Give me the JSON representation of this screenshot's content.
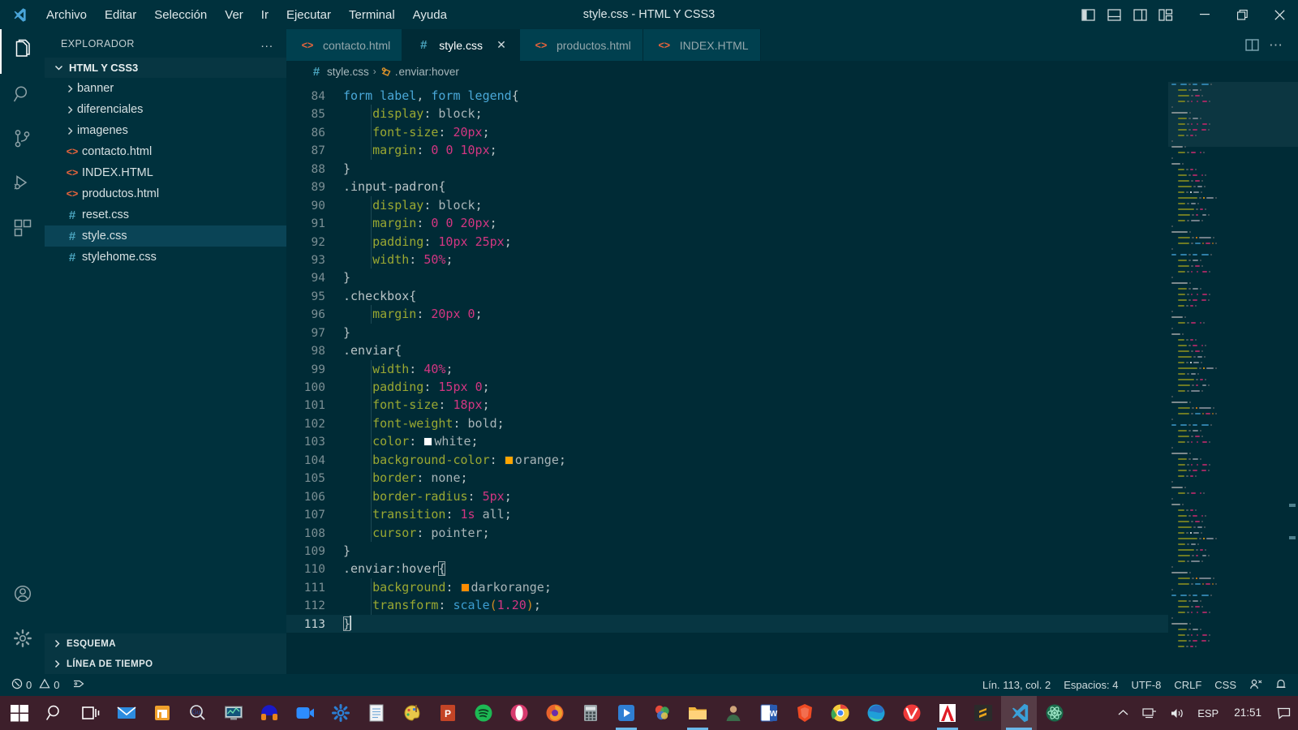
{
  "titlebar": {
    "window_title": "style.css - HTML Y CSS3",
    "menus": [
      "Archivo",
      "Editar",
      "Selección",
      "Ver",
      "Ir",
      "Ejecutar",
      "Terminal",
      "Ayuda"
    ],
    "layout_buttons": [
      "toggle-primary-sidebar",
      "toggle-panel",
      "toggle-secondary-sidebar",
      "customize-layout"
    ],
    "window_controls": [
      "minimize",
      "restore",
      "close"
    ]
  },
  "activitybar": {
    "items": [
      {
        "name": "explorer",
        "icon": "files-icon",
        "active": true
      },
      {
        "name": "search",
        "icon": "search-icon",
        "active": false
      },
      {
        "name": "source-control",
        "icon": "source-control-icon",
        "active": false
      },
      {
        "name": "run-debug",
        "icon": "run-debug-icon",
        "active": false
      },
      {
        "name": "extensions",
        "icon": "extensions-icon",
        "active": false
      }
    ],
    "bottom": [
      {
        "name": "accounts",
        "icon": "account-icon"
      },
      {
        "name": "manage",
        "icon": "gear-icon"
      }
    ]
  },
  "sidebar": {
    "title": "EXPLORADOR",
    "more_actions": "...",
    "root_folder": "HTML Y CSS3",
    "items": [
      {
        "label": "banner",
        "type": "folder",
        "icon": "chevron-right-icon",
        "selected": false
      },
      {
        "label": "diferenciales",
        "type": "folder",
        "icon": "chevron-right-icon",
        "selected": false
      },
      {
        "label": "imagenes",
        "type": "folder",
        "icon": "chevron-right-icon",
        "selected": false
      },
      {
        "label": "contacto.html",
        "type": "html",
        "icon": "html-file-icon",
        "selected": false
      },
      {
        "label": "INDEX.HTML",
        "type": "html",
        "icon": "html-file-icon",
        "selected": false
      },
      {
        "label": "productos.html",
        "type": "html",
        "icon": "html-file-icon",
        "selected": false
      },
      {
        "label": "reset.css",
        "type": "css",
        "icon": "css-file-icon",
        "selected": false
      },
      {
        "label": "style.css",
        "type": "css",
        "icon": "css-file-icon",
        "selected": true
      },
      {
        "label": "stylehome.css",
        "type": "css",
        "icon": "css-file-icon",
        "selected": false
      }
    ],
    "panels": [
      "ESQUEMA",
      "LÍNEA DE TIEMPO"
    ]
  },
  "tabs": [
    {
      "label": "contacto.html",
      "type": "html",
      "active": false,
      "closable": false
    },
    {
      "label": "style.css",
      "type": "css",
      "active": true,
      "closable": true,
      "close_label": "✕"
    },
    {
      "label": "productos.html",
      "type": "html",
      "active": false,
      "closable": false
    },
    {
      "label": "INDEX.HTML",
      "type": "html",
      "active": false,
      "closable": false
    }
  ],
  "editor_actions": [
    {
      "name": "split-editor",
      "icon": "split-editor-icon"
    },
    {
      "name": "more-actions",
      "icon": "ellipsis-icon",
      "label": "⋯"
    }
  ],
  "breadcrumb": {
    "file": "style.css",
    "separator": "›",
    "symbol": "enviar:hover",
    "symbol_prefix": ".",
    "symbol_icon": "css-rule-icon"
  },
  "statusbar": {
    "errors": "0",
    "warnings": "0",
    "ports_icon": "remote-ports-icon",
    "cursor_position": "Lín. 113, col. 2",
    "indentation": "Espacios: 4",
    "encoding": "UTF-8",
    "eol": "CRLF",
    "language": "CSS",
    "feedback_icon": "feedback-icon",
    "bell_icon": "bell-icon"
  },
  "taskbar": {
    "tray_language": "ESP",
    "tray_time": "21:51",
    "tray_icons": [
      "show-hidden-icon",
      "network-icon",
      "volume-icon"
    ],
    "action_center_icon": "action-center-icon",
    "items": [
      {
        "name": "start-button",
        "icon": "windows-start-icon"
      },
      {
        "name": "search-taskbar",
        "icon": "search-icon"
      },
      {
        "name": "task-view",
        "icon": "task-view-icon"
      },
      {
        "name": "mail-app",
        "icon": "mail-icon"
      },
      {
        "name": "store-app",
        "icon": "store-icon"
      },
      {
        "name": "guitar-app",
        "icon": "gu-icon"
      },
      {
        "name": "monitor-app",
        "icon": "monitor-chart-icon"
      },
      {
        "name": "headphones-app",
        "icon": "headphones-icon"
      },
      {
        "name": "zoom-app",
        "icon": "zoom-camera-icon"
      },
      {
        "name": "settings-app",
        "icon": "gear-icon"
      },
      {
        "name": "notepad-app",
        "icon": "notepad-icon"
      },
      {
        "name": "paint-app",
        "icon": "paint-palette-icon"
      },
      {
        "name": "powerpoint-app",
        "icon": "powerpoint-icon"
      },
      {
        "name": "spotify-app",
        "icon": "spotify-icon"
      },
      {
        "name": "opera-app",
        "icon": "opera-icon"
      },
      {
        "name": "firefox-app",
        "icon": "firefox-icon"
      },
      {
        "name": "calculator-app",
        "icon": "calculator-icon"
      },
      {
        "name": "media-player-app",
        "icon": "media-play-icon"
      },
      {
        "name": "photos-app",
        "icon": "photos-icon"
      },
      {
        "name": "file-explorer",
        "icon": "folder-icon"
      },
      {
        "name": "people-app",
        "icon": "person-icon"
      },
      {
        "name": "word-app",
        "icon": "word-icon"
      },
      {
        "name": "brave-app",
        "icon": "brave-icon"
      },
      {
        "name": "chrome-app",
        "icon": "chrome-icon"
      },
      {
        "name": "edge-app",
        "icon": "edge-icon"
      },
      {
        "name": "vivaldi-app",
        "icon": "vivaldi-icon"
      },
      {
        "name": "adobe-app",
        "icon": "adobe-icon"
      },
      {
        "name": "sublime-app",
        "icon": "sublime-icon"
      },
      {
        "name": "vscode-app",
        "icon": "vscode-icon"
      },
      {
        "name": "react-app",
        "icon": "react-icon"
      }
    ]
  },
  "code": {
    "language": "css",
    "first_line": 84,
    "current_line": 113,
    "lines": [
      {
        "n": 84,
        "tokens": [
          {
            "t": "form",
            "c": "sel"
          },
          {
            "t": " ",
            "c": "punc"
          },
          {
            "t": "label",
            "c": "sel"
          },
          {
            "t": ", ",
            "c": "punc"
          },
          {
            "t": "form",
            "c": "sel"
          },
          {
            "t": " ",
            "c": "punc"
          },
          {
            "t": "legend",
            "c": "sel"
          },
          {
            "t": "{",
            "c": "punc"
          }
        ]
      },
      {
        "n": 85,
        "indent": true,
        "tokens": [
          {
            "t": "    display",
            "c": "prop"
          },
          {
            "t": ": ",
            "c": "punc"
          },
          {
            "t": "block",
            "c": "val"
          },
          {
            "t": ";",
            "c": "punc"
          }
        ]
      },
      {
        "n": 86,
        "indent": true,
        "tokens": [
          {
            "t": "    font-size",
            "c": "prop"
          },
          {
            "t": ": ",
            "c": "punc"
          },
          {
            "t": "20px",
            "c": "num"
          },
          {
            "t": ";",
            "c": "punc"
          }
        ]
      },
      {
        "n": 87,
        "indent": true,
        "tokens": [
          {
            "t": "    margin",
            "c": "prop"
          },
          {
            "t": ": ",
            "c": "punc"
          },
          {
            "t": "0",
            "c": "num"
          },
          {
            "t": " ",
            "c": "punc"
          },
          {
            "t": "0",
            "c": "num"
          },
          {
            "t": " ",
            "c": "punc"
          },
          {
            "t": "10px",
            "c": "num"
          },
          {
            "t": ";",
            "c": "punc"
          }
        ]
      },
      {
        "n": 88,
        "tokens": [
          {
            "t": "}",
            "c": "punc"
          }
        ]
      },
      {
        "n": 89,
        "tokens": [
          {
            "t": ".input-padron",
            "c": "cls"
          },
          {
            "t": "{",
            "c": "punc"
          }
        ]
      },
      {
        "n": 90,
        "indent": true,
        "tokens": [
          {
            "t": "    display",
            "c": "prop"
          },
          {
            "t": ": ",
            "c": "punc"
          },
          {
            "t": "block",
            "c": "val"
          },
          {
            "t": ";",
            "c": "punc"
          }
        ]
      },
      {
        "n": 91,
        "indent": true,
        "tokens": [
          {
            "t": "    margin",
            "c": "prop"
          },
          {
            "t": ": ",
            "c": "punc"
          },
          {
            "t": "0",
            "c": "num"
          },
          {
            "t": " ",
            "c": "punc"
          },
          {
            "t": "0",
            "c": "num"
          },
          {
            "t": " ",
            "c": "punc"
          },
          {
            "t": "20px",
            "c": "num"
          },
          {
            "t": ";",
            "c": "punc"
          }
        ]
      },
      {
        "n": 92,
        "indent": true,
        "tokens": [
          {
            "t": "    padding",
            "c": "prop"
          },
          {
            "t": ": ",
            "c": "punc"
          },
          {
            "t": "10px",
            "c": "num"
          },
          {
            "t": " ",
            "c": "punc"
          },
          {
            "t": "25px",
            "c": "num"
          },
          {
            "t": ";",
            "c": "punc"
          }
        ]
      },
      {
        "n": 93,
        "indent": true,
        "tokens": [
          {
            "t": "    width",
            "c": "prop"
          },
          {
            "t": ": ",
            "c": "punc"
          },
          {
            "t": "50%",
            "c": "num"
          },
          {
            "t": ";",
            "c": "punc"
          }
        ]
      },
      {
        "n": 94,
        "tokens": [
          {
            "t": "}",
            "c": "punc"
          }
        ]
      },
      {
        "n": 95,
        "tokens": [
          {
            "t": ".checkbox",
            "c": "cls"
          },
          {
            "t": "{",
            "c": "punc"
          }
        ]
      },
      {
        "n": 96,
        "indent": true,
        "tokens": [
          {
            "t": "    margin",
            "c": "prop"
          },
          {
            "t": ": ",
            "c": "punc"
          },
          {
            "t": "20px",
            "c": "num"
          },
          {
            "t": " ",
            "c": "punc"
          },
          {
            "t": "0",
            "c": "num"
          },
          {
            "t": ";",
            "c": "punc"
          }
        ]
      },
      {
        "n": 97,
        "tokens": [
          {
            "t": "}",
            "c": "punc"
          }
        ]
      },
      {
        "n": 98,
        "tokens": [
          {
            "t": ".enviar",
            "c": "cls"
          },
          {
            "t": "{",
            "c": "punc"
          }
        ]
      },
      {
        "n": 99,
        "indent": true,
        "tokens": [
          {
            "t": "    width",
            "c": "prop"
          },
          {
            "t": ": ",
            "c": "punc"
          },
          {
            "t": "40%",
            "c": "num"
          },
          {
            "t": ";",
            "c": "punc"
          }
        ]
      },
      {
        "n": 100,
        "indent": true,
        "tokens": [
          {
            "t": "    padding",
            "c": "prop"
          },
          {
            "t": ": ",
            "c": "punc"
          },
          {
            "t": "15px",
            "c": "num"
          },
          {
            "t": " ",
            "c": "punc"
          },
          {
            "t": "0",
            "c": "num"
          },
          {
            "t": ";",
            "c": "punc"
          }
        ]
      },
      {
        "n": 101,
        "indent": true,
        "tokens": [
          {
            "t": "    font-size",
            "c": "prop"
          },
          {
            "t": ": ",
            "c": "punc"
          },
          {
            "t": "18px",
            "c": "num"
          },
          {
            "t": ";",
            "c": "punc"
          }
        ]
      },
      {
        "n": 102,
        "indent": true,
        "tokens": [
          {
            "t": "    font-weight",
            "c": "prop"
          },
          {
            "t": ": ",
            "c": "punc"
          },
          {
            "t": "bold",
            "c": "val"
          },
          {
            "t": ";",
            "c": "punc"
          }
        ]
      },
      {
        "n": 103,
        "indent": true,
        "tokens": [
          {
            "t": "    color",
            "c": "prop"
          },
          {
            "t": ": ",
            "c": "punc"
          },
          {
            "t": "",
            "c": "swatch",
            "color": "#ffffff"
          },
          {
            "t": "white",
            "c": "val"
          },
          {
            "t": ";",
            "c": "punc"
          }
        ]
      },
      {
        "n": 104,
        "indent": true,
        "tokens": [
          {
            "t": "    background-color",
            "c": "prop"
          },
          {
            "t": ": ",
            "c": "punc"
          },
          {
            "t": "",
            "c": "swatch",
            "color": "#ffa500"
          },
          {
            "t": "orange",
            "c": "val"
          },
          {
            "t": ";",
            "c": "punc"
          }
        ]
      },
      {
        "n": 105,
        "indent": true,
        "tokens": [
          {
            "t": "    border",
            "c": "prop"
          },
          {
            "t": ": ",
            "c": "punc"
          },
          {
            "t": "none",
            "c": "val"
          },
          {
            "t": ";",
            "c": "punc"
          }
        ]
      },
      {
        "n": 106,
        "indent": true,
        "tokens": [
          {
            "t": "    border-radius",
            "c": "prop"
          },
          {
            "t": ": ",
            "c": "punc"
          },
          {
            "t": "5px",
            "c": "num"
          },
          {
            "t": ";",
            "c": "punc"
          }
        ]
      },
      {
        "n": 107,
        "indent": true,
        "tokens": [
          {
            "t": "    transition",
            "c": "prop"
          },
          {
            "t": ": ",
            "c": "punc"
          },
          {
            "t": "1s",
            "c": "num"
          },
          {
            "t": " ",
            "c": "punc"
          },
          {
            "t": "all",
            "c": "val"
          },
          {
            "t": ";",
            "c": "punc"
          }
        ]
      },
      {
        "n": 108,
        "indent": true,
        "tokens": [
          {
            "t": "    cursor",
            "c": "prop"
          },
          {
            "t": ": ",
            "c": "punc"
          },
          {
            "t": "pointer",
            "c": "val"
          },
          {
            "t": ";",
            "c": "punc"
          }
        ]
      },
      {
        "n": 109,
        "tokens": [
          {
            "t": "}",
            "c": "punc"
          }
        ]
      },
      {
        "n": 110,
        "tokens": [
          {
            "t": ".enviar:hover",
            "c": "cls"
          },
          {
            "t": "{",
            "c": "match"
          }
        ]
      },
      {
        "n": 111,
        "indent": true,
        "tokens": [
          {
            "t": "    background",
            "c": "prop"
          },
          {
            "t": ": ",
            "c": "punc"
          },
          {
            "t": "",
            "c": "swatch",
            "color": "#ff8c00"
          },
          {
            "t": "darkorange",
            "c": "val"
          },
          {
            "t": ";",
            "c": "punc"
          }
        ]
      },
      {
        "n": 112,
        "indent": true,
        "tokens": [
          {
            "t": "    transform",
            "c": "prop"
          },
          {
            "t": ": ",
            "c": "punc"
          },
          {
            "t": "scale",
            "c": "fn"
          },
          {
            "t": "(",
            "c": "paren"
          },
          {
            "t": "1.20",
            "c": "num"
          },
          {
            "t": ")",
            "c": "paren"
          },
          {
            "t": ";",
            "c": "punc"
          }
        ]
      },
      {
        "n": 113,
        "current": true,
        "cursor": true,
        "tokens": [
          {
            "t": "}",
            "c": "match"
          }
        ]
      }
    ]
  },
  "theme": {
    "editor_bg": "#002b36",
    "chrome_bg": "#00313d",
    "tab_inactive_bg": "#00404f",
    "accent_orange": "#e8643c",
    "accent_css": "#4aa5bf",
    "taskbar_bg": "#3d1f2b"
  }
}
